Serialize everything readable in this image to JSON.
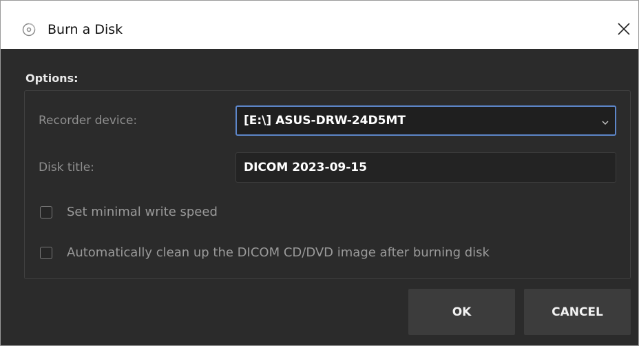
{
  "window": {
    "title": "Burn a Disk",
    "app_icon": "disc-burn-icon",
    "close_icon": "close-icon"
  },
  "options": {
    "label": "Options:",
    "recorder_device": {
      "label": "Recorder device:",
      "value": "[E:\\] ASUS-DRW-24D5MT",
      "dropdown_icon": "chevron-down-icon"
    },
    "disk_title": {
      "label": "Disk title:",
      "value": "DICOM 2023-09-15"
    },
    "checkboxes": [
      {
        "label": "Set minimal write speed",
        "checked": false
      },
      {
        "label": "Automatically clean up the DICOM CD/DVD image after burning disk",
        "checked": false
      }
    ]
  },
  "buttons": {
    "ok": "OK",
    "cancel": "CANCEL"
  },
  "colors": {
    "background": "#2b2b2b",
    "focus_border": "#5d86c9",
    "button_bg": "#3c3c3c"
  }
}
